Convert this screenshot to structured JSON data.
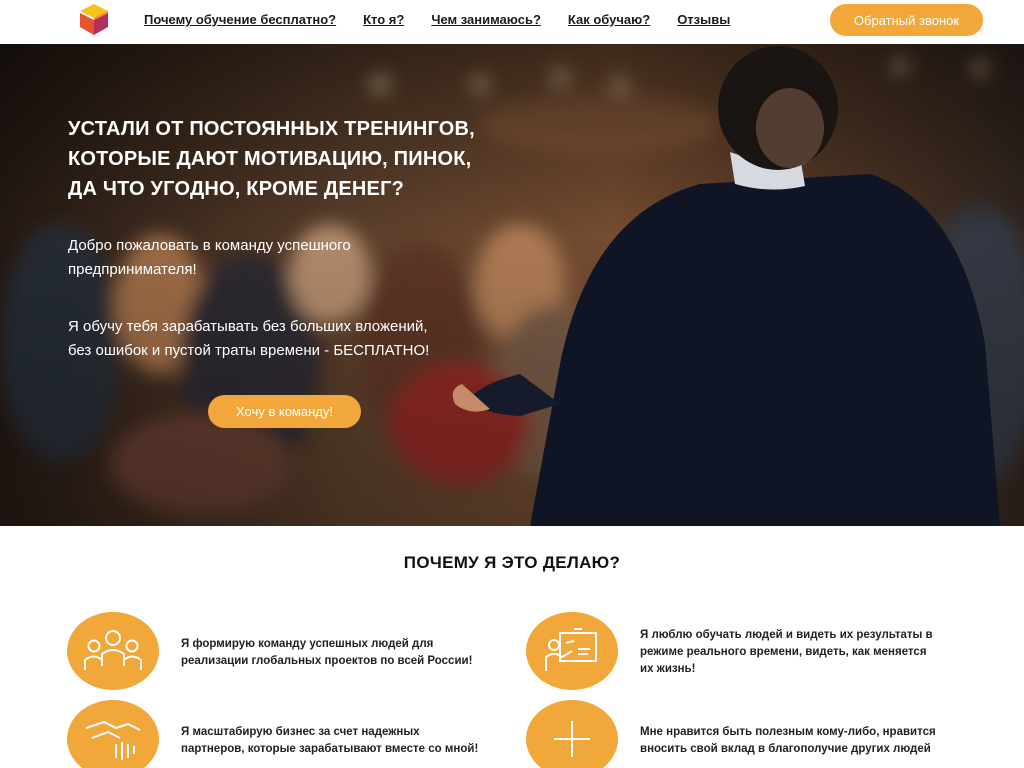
{
  "header": {
    "nav": [
      "Почему обучение бесплатно?",
      "Кто я?",
      "Чем занимаюсь?",
      "Как обучаю?",
      "Отзывы"
    ],
    "callback_label": "Обратный звонок"
  },
  "hero": {
    "title_lines": [
      "Устали от постоянных тренингов,",
      "которые дают мотивацию, пинок,",
      "да что угодно, кроме денег?"
    ],
    "paragraph1_lines": [
      "Добро пожаловать в команду успешного",
      "предпринимателя!"
    ],
    "paragraph2_lines": [
      "Я обучу тебя зарабатывать без больших вложений,",
      "без ошибок и пустой траты времени - БЕСПЛАТНО!"
    ],
    "cta_label": "Хочу в команду!"
  },
  "why": {
    "title": "ПОЧЕМУ Я ЭТО ДЕЛАЮ?",
    "reasons": [
      {
        "icon": "team-icon",
        "lines": [
          "Я формирую команду успешных людей для",
          "реализации глобальных проектов по всей России!"
        ]
      },
      {
        "icon": "presentation-icon",
        "lines": [
          "Я люблю обучать людей и видеть их результаты в",
          "режиме реального времени, видеть, как меняется",
          "их жизнь!"
        ]
      },
      {
        "icon": "handshake-icon",
        "lines": [
          "Я масштабирую бизнес за счет надежных",
          "партнеров, которые зарабатывают вместе со мной!"
        ]
      },
      {
        "icon": "plus-icon",
        "lines": [
          "Мне нравится быть полезным кому-либо, нравится",
          "вносить свой вклад в благополучие других людей"
        ]
      }
    ]
  },
  "colors": {
    "accent": "#f2a73a",
    "text_dark": "#1c1c1c"
  }
}
